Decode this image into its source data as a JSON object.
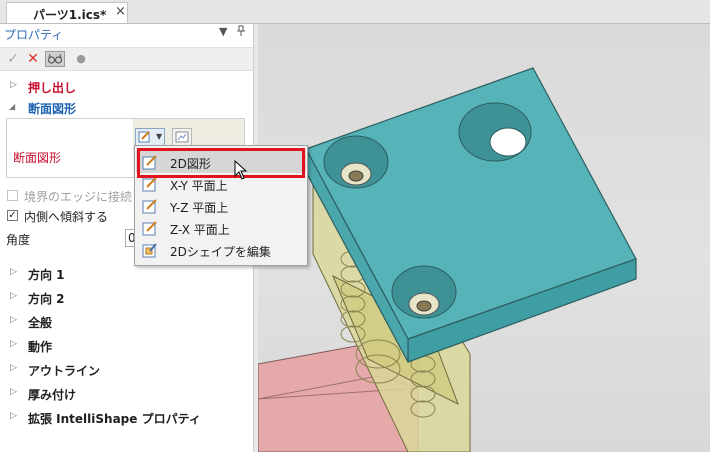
{
  "document_tab": {
    "title": "パーツ1.ics*",
    "close_symbol": "×"
  },
  "panel": {
    "title": "プロパティ",
    "pin_menu": "▼",
    "pin": "📌",
    "close": "×",
    "toolbar": {
      "ok_icon": "check-icon",
      "cancel_icon": "x-icon",
      "preview_icon": "glasses-icon",
      "dot_icon": "dot-icon"
    },
    "sections_top": [
      {
        "label": "押し出し",
        "expanded": false,
        "color": "#c8102e"
      },
      {
        "label": "断面図形",
        "expanded": true,
        "color": "#2063b0"
      }
    ],
    "profile_label": "断面図形",
    "checkbox_edge": {
      "label": "境界のエッジに接続し",
      "checked": false,
      "disabled": true
    },
    "checkbox_taper": {
      "label": "内側へ傾斜する",
      "checked": true
    },
    "angle_label": "角度",
    "angle_value": "0",
    "sections_bottom": [
      {
        "label": "方向 1"
      },
      {
        "label": "方向 2"
      },
      {
        "label": "全般"
      },
      {
        "label": "動作"
      },
      {
        "label": "アウトライン"
      },
      {
        "label": "厚み付け"
      },
      {
        "label": "拡張 IntelliShape プロパティ"
      }
    ]
  },
  "dropdown_menu": {
    "items": [
      {
        "label": "2D図形",
        "icon": "sketch-icon",
        "highlighted": true
      },
      {
        "label": "X-Y 平面上",
        "icon": "plane-xy-icon"
      },
      {
        "label": "Y-Z 平面上",
        "icon": "plane-yz-icon"
      },
      {
        "label": "Z-X 平面上",
        "icon": "plane-zx-icon"
      },
      {
        "label": "2Dシェイプを編集",
        "icon": "edit-shape-icon"
      }
    ]
  },
  "colors": {
    "accent_blue": "#2f6fb5",
    "highlight_red": "#e1141e",
    "teal_part": "#56b4b8",
    "yellow_part": "#d9d79a",
    "pink_part": "#e6a9a9"
  }
}
